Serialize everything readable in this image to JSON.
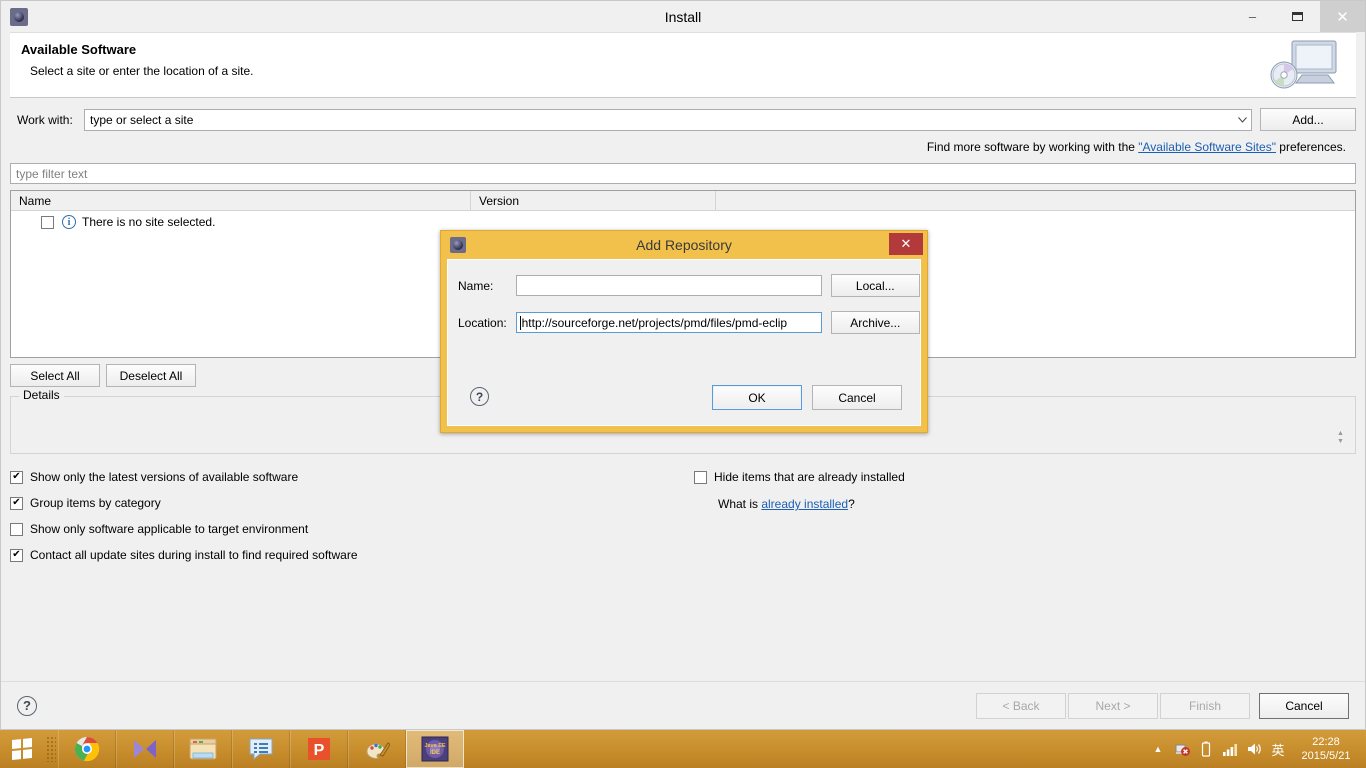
{
  "window": {
    "title": "Install",
    "icon": "eclipse-icon",
    "minimize": "–",
    "maximize": "❑",
    "close": "✕"
  },
  "header": {
    "title": "Available Software",
    "subtitle": "Select a site or enter the location of a site.",
    "icon": "computer-cd-icon"
  },
  "work_with": {
    "label": "Work with:",
    "value": "type or select a site",
    "dropdown_arrow": "⌄",
    "add_button": "Add..."
  },
  "find_more": {
    "prefix": "Find more software by working with the ",
    "link": "\"Available Software Sites\"",
    "suffix": " preferences."
  },
  "filter": {
    "placeholder": "type filter text"
  },
  "table": {
    "columns": [
      "Name",
      "Version"
    ],
    "rows": [
      {
        "checked": false,
        "icon": "info-icon",
        "name": "There is no site selected.",
        "version": ""
      }
    ]
  },
  "selection_buttons": {
    "select_all": "Select All",
    "deselect_all": "Deselect All"
  },
  "details": {
    "legend": "Details",
    "text": "",
    "spinner_up": "▲",
    "spinner_down": "▼"
  },
  "options": {
    "left": [
      {
        "label": "Show only the latest versions of available software",
        "checked": true
      },
      {
        "label": "Group items by category",
        "checked": true
      },
      {
        "label": "Show only software applicable to target environment",
        "checked": false
      },
      {
        "label": "Contact all update sites during install to find required software",
        "checked": true
      }
    ],
    "right": [
      {
        "label": "Hide items that are already installed",
        "checked": false
      }
    ],
    "what_is_prefix": "What is ",
    "what_is_link": "already installed",
    "what_is_suffix": "?"
  },
  "wizard_buttons": {
    "help": "?",
    "back": "< Back",
    "next": "Next >",
    "finish": "Finish",
    "cancel": "Cancel"
  },
  "modal": {
    "title": "Add Repository",
    "icon": "eclipse-icon",
    "close": "✕",
    "name_label": "Name:",
    "name_value": "",
    "local_button": "Local...",
    "location_label": "Location:",
    "location_value": "http://sourceforge.net/projects/pmd/files/pmd-eclip",
    "archive_button": "Archive...",
    "help": "?",
    "ok_button": "OK",
    "cancel_button": "Cancel"
  },
  "taskbar": {
    "start": "windows-start-icon",
    "items": [
      {
        "name": "chrome-icon",
        "active": false
      },
      {
        "name": "media-player-icon",
        "active": false
      },
      {
        "name": "file-explorer-icon",
        "active": false
      },
      {
        "name": "notes-icon",
        "active": false
      },
      {
        "name": "powerpoint-icon",
        "active": false
      },
      {
        "name": "paint-icon",
        "active": false
      },
      {
        "name": "eclipse-java-ee-ide-icon",
        "active": true
      }
    ],
    "tray": {
      "show_hidden": "▲",
      "network_icon": "network-error-icon",
      "battery_icon": "battery-icon",
      "signal_icon": "signal-icon",
      "volume_icon": "volume-icon",
      "ime_icon": "英",
      "time": "22:28",
      "date": "2015/5/21"
    }
  },
  "colors": {
    "modal_border": "#f2c14b",
    "link": "#1c5fb4",
    "taskbar": "#c98f2e",
    "close_button": "#b33a3a"
  }
}
